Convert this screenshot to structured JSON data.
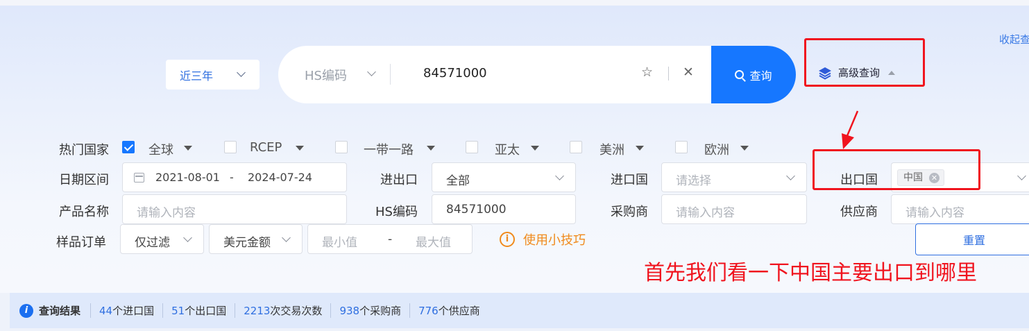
{
  "header": {
    "collapse_label": "收起查"
  },
  "search": {
    "range_select": "近三年",
    "type_select": "HS编码",
    "query_value": "84571000",
    "submit_label": "查询",
    "advanced_label": "高级查询"
  },
  "filters": {
    "hot_countries_label": "热门国家",
    "countries": [
      {
        "label": "全球",
        "checked": true
      },
      {
        "label": "RCEP",
        "checked": false
      },
      {
        "label": "一带一路",
        "checked": false
      },
      {
        "label": "亚太",
        "checked": false
      },
      {
        "label": "美洲",
        "checked": false
      },
      {
        "label": "欧洲",
        "checked": false
      }
    ],
    "date_label": "日期区间",
    "date_start": "2021-08-01",
    "date_sep": "-",
    "date_end": "2024-07-24",
    "import_export_label": "进出口",
    "import_export_value": "全部",
    "import_country_label": "进口国",
    "import_country_placeholder": "请选择",
    "export_country_label": "出口国",
    "export_country_tag": "中国",
    "product_label": "产品名称",
    "product_placeholder": "请输入内容",
    "hs_label": "HS编码",
    "hs_value": "84571000",
    "buyer_label": "采购商",
    "buyer_placeholder": "请输入内容",
    "supplier_label": "供应商",
    "supplier_placeholder": "请输入内容",
    "sample_label": "样品订单",
    "sample_value": "仅过滤",
    "currency_value": "美元金额",
    "min_placeholder": "最小值",
    "range_sep": "-",
    "max_placeholder": "最大值",
    "tips_label": "使用小技巧",
    "reset_label": "重置"
  },
  "annotation": "首先我们看一下中国主要出口到哪里",
  "results": {
    "title": "查询结果",
    "items": [
      {
        "num": "44",
        "label": "个进口国"
      },
      {
        "num": "51",
        "label": "个出口国"
      },
      {
        "num": "2213",
        "label": "次交易次数"
      },
      {
        "num": "938",
        "label": "个采购商"
      },
      {
        "num": "776",
        "label": "个供应商"
      }
    ]
  },
  "colors": {
    "primary": "#1677ff",
    "annotation": "#f0141e",
    "tips": "#f08a1c"
  }
}
